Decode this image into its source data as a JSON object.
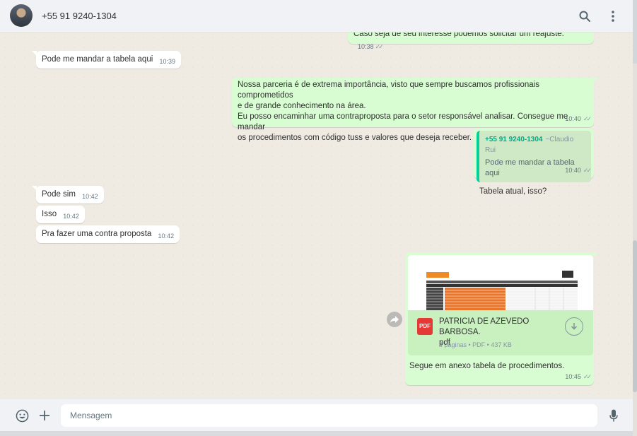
{
  "header": {
    "contact_name": "+55 91 9240-1304",
    "icons": [
      "avatar",
      "search-icon",
      "menu-icon"
    ]
  },
  "messages": [
    {
      "dir": "out",
      "text": "Caso seja de seu interesse podemos solicitar um reajuste.",
      "time": "10:38",
      "status": "read"
    },
    {
      "dir": "in",
      "text": "Pode me mandar a tabela aqui",
      "time": "10:39"
    },
    {
      "dir": "out",
      "lines": [
        "Nossa parceria é de extrema importância, visto que sempre buscamos profissionais comprometidos",
        "e de grande conhecimento na área.",
        "Eu posso encaminhar uma contraproposta para o setor responsável analisar. Consegue me mandar",
        "os procedimentos com código tuss e valores que deseja receber."
      ],
      "time": "10:40",
      "status": "read"
    },
    {
      "dir": "out",
      "quote": {
        "author": "+55 91 9240-1304",
        "alias": "~Claudio Rui",
        "text": "Pode me mandar a tabela aqui"
      },
      "text": "Tabela atual, isso?",
      "time": "10:40",
      "status": "read"
    },
    {
      "dir": "in",
      "text": "Pode sim",
      "time": "10:42"
    },
    {
      "dir": "in",
      "text": "Isso",
      "time": "10:42"
    },
    {
      "dir": "in",
      "text": "Pra fazer uma contra proposta",
      "time": "10:42"
    },
    {
      "dir": "out",
      "document": {
        "name_line1": "PATRICIA DE AZEVEDO BARBOSA.",
        "name_line2": "pdf",
        "info": "4 páginas • PDF • 437 KB",
        "icon_label": "PDF"
      },
      "caption": "Segue em anexo tabela de procedimentos.",
      "time": "10:45",
      "status": "read"
    }
  ],
  "composer": {
    "placeholder": "Mensagem"
  },
  "colors": {
    "incoming_bubble": "#ffffff",
    "outgoing_bubble": "#d9fdd3",
    "chat_background": "#efeae2",
    "header_background": "#f0f2f5",
    "accent": "#06cf9c",
    "pdf_red": "#e53935"
  }
}
